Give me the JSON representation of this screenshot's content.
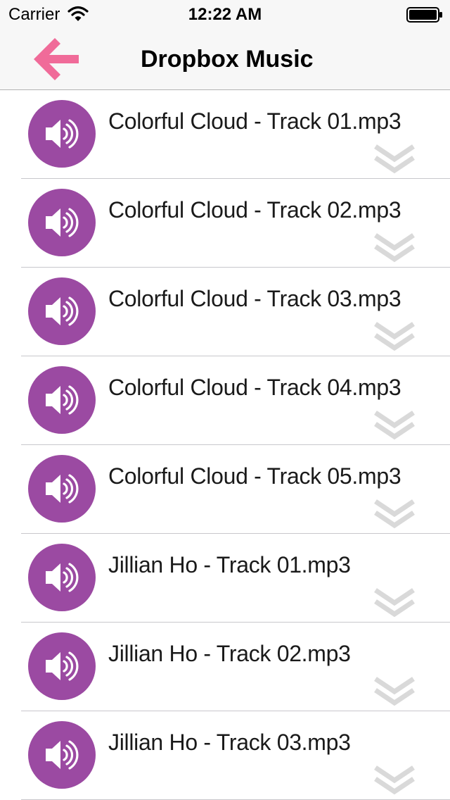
{
  "status_bar": {
    "carrier": "Carrier",
    "time": "12:22 AM"
  },
  "nav": {
    "title": "Dropbox Music",
    "back_icon": "back-arrow-icon",
    "back_color": "#f06b99"
  },
  "colors": {
    "speaker_badge": "#9b4aa2",
    "download_chevron": "#d9d9d9"
  },
  "tracks": [
    {
      "name": "Colorful Cloud - Track 01.mp3"
    },
    {
      "name": "Colorful Cloud - Track 02.mp3"
    },
    {
      "name": "Colorful Cloud - Track 03.mp3"
    },
    {
      "name": "Colorful Cloud - Track 04.mp3"
    },
    {
      "name": "Colorful Cloud - Track 05.mp3"
    },
    {
      "name": "Jillian Ho - Track 01.mp3"
    },
    {
      "name": "Jillian Ho - Track 02.mp3"
    },
    {
      "name": "Jillian Ho - Track 03.mp3"
    }
  ]
}
